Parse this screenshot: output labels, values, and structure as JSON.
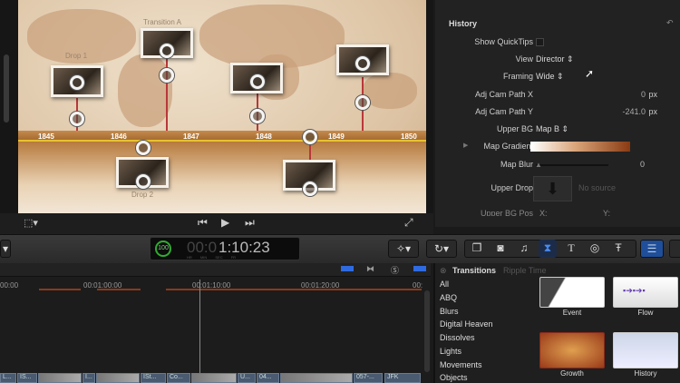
{
  "viewer": {
    "years": [
      "1845",
      "1846",
      "1847",
      "1848",
      "1849",
      "1850"
    ],
    "labels": {
      "drop1": "Drop 1",
      "transition_a": "Transition A",
      "drop2": "Drop 2"
    }
  },
  "inspector": {
    "title": "History",
    "rows": {
      "show_quicktips": "Show QuickTips",
      "view": "View",
      "view_value": "Director",
      "framing": "Framing",
      "framing_value": "Wide",
      "cam_x": "Adj Cam Path X",
      "cam_x_value": "0",
      "cam_y": "Adj Cam Path Y",
      "cam_y_value": "-241.0",
      "px": "px",
      "upper_bg": "Upper BG",
      "upper_bg_value": "Map B",
      "map_gradient": "Map Gradient",
      "map_blur": "Map Blur",
      "map_blur_value": "0",
      "upper_drop": "Upper Drop",
      "no_source": "No source",
      "upper_bg_pos": "Upper BG Pos",
      "x": "X:",
      "y": "Y:"
    },
    "gradient_colors": [
      "#ffffff",
      "#8a3a12"
    ]
  },
  "toolbar": {
    "timecode": "1:10:23",
    "timecode_dim": "00:0",
    "timecode_units": [
      "HR",
      "MIN",
      "SEC",
      "FR"
    ],
    "zoom": "100"
  },
  "timeline": {
    "ruler": [
      "00:00",
      "00:01:00:00",
      "00:01:10:00",
      "00:01:20:00",
      "00:"
    ],
    "clips": [
      "L...",
      "IS...",
      "I...",
      "ISt...",
      "Co...",
      "U...",
      "04...",
      "057-...",
      "JFK"
    ]
  },
  "browser": {
    "title": "Transitions",
    "subtitle": "Ripple Time",
    "categories": [
      "All",
      "ABQ",
      "Blurs",
      "Digital Heaven",
      "Dissolves",
      "Lights",
      "Movements",
      "Objects"
    ],
    "thumbs": [
      "Event",
      "Flow",
      "Growth",
      "History"
    ]
  }
}
